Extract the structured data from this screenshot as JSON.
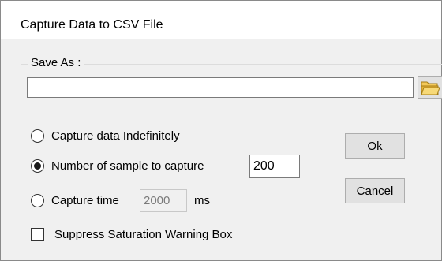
{
  "window": {
    "title": "Capture Data to CSV File"
  },
  "save_as": {
    "group_label": "Save As :",
    "path_value": "",
    "browse_icon": "folder-open-icon"
  },
  "options": {
    "indefinite_label": "Capture data Indefinitely",
    "samples_label": "Number of sample to capture",
    "samples_value": "200",
    "time_label": "Capture time",
    "time_value": "2000",
    "time_unit": "ms",
    "selected": "samples",
    "suppress_label": "Suppress Saturation Warning Box",
    "suppress_checked": false
  },
  "buttons": {
    "ok": "Ok",
    "cancel": "Cancel"
  },
  "colors": {
    "window_bg": "#f0f0f0",
    "title_bg": "#ffffff",
    "button_bg": "#e1e1e1",
    "folder_yellow": "#e8b53a"
  }
}
